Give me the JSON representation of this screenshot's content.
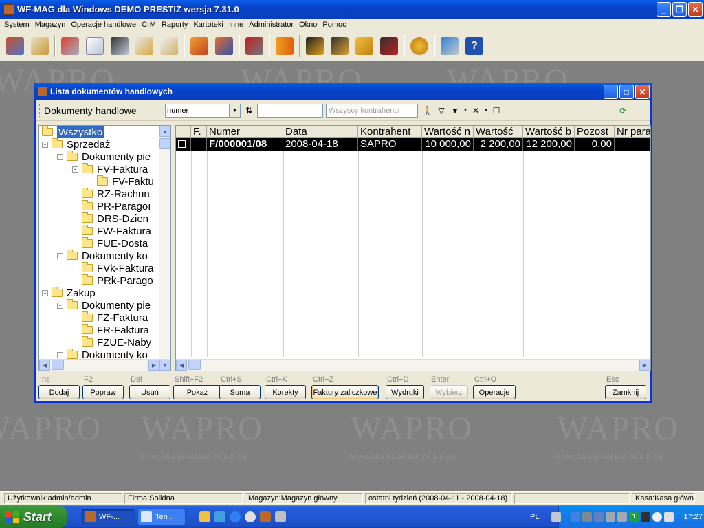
{
  "app": {
    "title": "WF-MAG dla Windows DEMO PRESTIŻ  wersja 7.31.0",
    "menu": [
      "System",
      "Magazyn",
      "Operacje handlowe",
      "CrM",
      "Raporty",
      "Kartoteki",
      "Inne",
      "Administrator",
      "Okno",
      "Pomoc"
    ]
  },
  "watermark": {
    "logo": "WAPRO",
    "tagline": "OPROGRAMOWANIE DLA FIRM"
  },
  "child": {
    "title": "Lista dokumentów handlowych",
    "toolbar_label": "Dokumenty handlowe",
    "sort_field": "numer",
    "search_value": "",
    "contractor_placeholder": "Wszyscy kontrahenci"
  },
  "tree": [
    {
      "label": "Wszystko",
      "level": 0,
      "expander": "",
      "selected": true
    },
    {
      "label": "Sprzedaż",
      "level": 0,
      "expander": "-"
    },
    {
      "label": "Dokumenty pie",
      "level": 1,
      "expander": "-"
    },
    {
      "label": "FV-Faktura",
      "level": 2,
      "expander": "-"
    },
    {
      "label": "FV-Faktu",
      "level": 3,
      "expander": ""
    },
    {
      "label": "RZ-Rachun",
      "level": 2,
      "expander": ""
    },
    {
      "label": "PR-Paragoı",
      "level": 2,
      "expander": ""
    },
    {
      "label": "DRS-Dzien",
      "level": 2,
      "expander": ""
    },
    {
      "label": "FW-Faktura",
      "level": 2,
      "expander": ""
    },
    {
      "label": "FUE-Dosta",
      "level": 2,
      "expander": ""
    },
    {
      "label": "Dokumenty ko",
      "level": 1,
      "expander": "-"
    },
    {
      "label": "FVk-Faktura",
      "level": 2,
      "expander": ""
    },
    {
      "label": "PRk-Parago",
      "level": 2,
      "expander": ""
    },
    {
      "label": "Zakup",
      "level": 0,
      "expander": "-"
    },
    {
      "label": "Dokumenty pie",
      "level": 1,
      "expander": "-"
    },
    {
      "label": "FZ-Faktura",
      "level": 2,
      "expander": ""
    },
    {
      "label": "FR-Faktura",
      "level": 2,
      "expander": ""
    },
    {
      "label": "FZUE-Naby",
      "level": 2,
      "expander": ""
    },
    {
      "label": "Dokumenty ko",
      "level": 1,
      "expander": "-"
    }
  ],
  "grid": {
    "columns": [
      "F.",
      "Numer",
      "Data",
      "Kontrahent",
      "Wartość n",
      "Wartość",
      "Wartość b",
      "Pozost",
      "Nr para"
    ],
    "rows": [
      [
        "",
        "F/000001/08",
        "2008-04-18",
        "SAPRO",
        "10 000,00",
        "2 200,00",
        "12 200,00",
        "0,00",
        ""
      ]
    ]
  },
  "buttons": [
    {
      "key": "Ins",
      "label": "Dodaj"
    },
    {
      "key": "F2",
      "label": "Popraw"
    },
    {
      "key": "Del",
      "label": "Usuń"
    },
    {
      "key": "Shift+F2",
      "label": "Pokaż"
    },
    {
      "key": "Ctrl+S",
      "label": "Suma"
    },
    {
      "key": "Ctrl+K",
      "label": "Korekty"
    },
    {
      "key": "Ctrl+Z",
      "label": "Faktury zaliczkowe"
    },
    {
      "key": "Ctrl+D",
      "label": "Wydruki"
    },
    {
      "key": "Enter",
      "label": "Wybierz"
    },
    {
      "key": "Ctrl+O",
      "label": "Operacje"
    },
    {
      "key": "Esc",
      "label": "Zamknij"
    }
  ],
  "status": [
    "Użytkownik:admin/admin",
    "Firma:Solidna",
    "Magazyn:Magazyn główny",
    "ostatni tydzień (2008-04-11 - 2008-04-18)",
    "",
    "Kasa:Kasa główn"
  ],
  "taskbar": {
    "start": "Start",
    "tasks": [
      "WF-...",
      "Ten ..."
    ],
    "lang": "PL",
    "clock": "17:27"
  }
}
